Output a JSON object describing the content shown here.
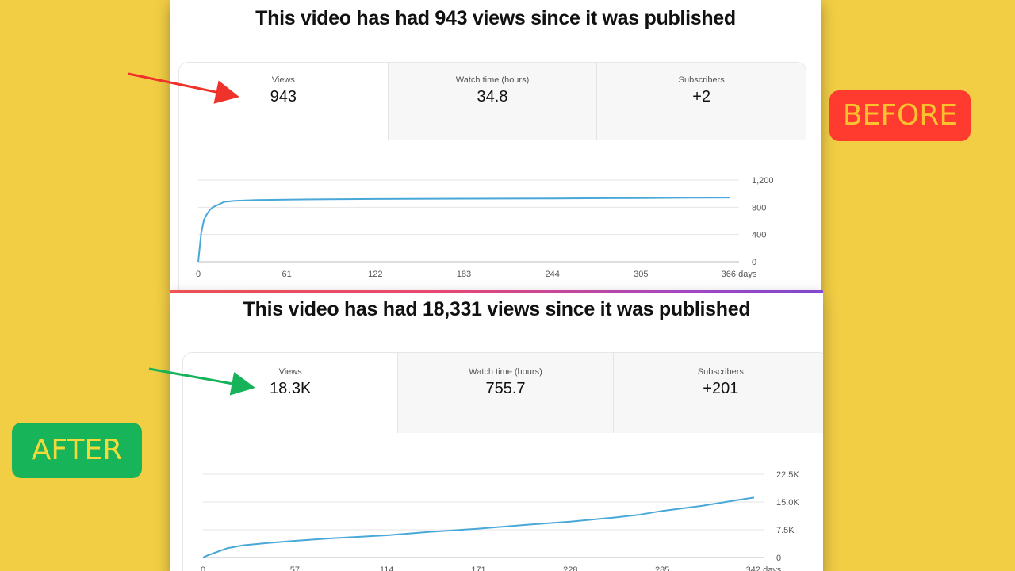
{
  "before": {
    "badge": "BEFORE",
    "headline": "This video has had 943 views since it was published",
    "tabs": [
      {
        "label": "Views",
        "value": "943"
      },
      {
        "label": "Watch time (hours)",
        "value": "34.8"
      },
      {
        "label": "Subscribers",
        "value": "+2"
      }
    ],
    "chart_data": {
      "type": "line",
      "x_ticks": [
        "0",
        "61",
        "122",
        "183",
        "244",
        "305",
        "366 days"
      ],
      "y_ticks": [
        "0",
        "400",
        "800",
        "1,200"
      ],
      "ylim": [
        0,
        1200
      ],
      "xlim": [
        0,
        366
      ],
      "series": [
        {
          "x": [
            0,
            2,
            4,
            6,
            8,
            10,
            14,
            18,
            25,
            40,
            61,
            90,
            122,
            183,
            244,
            305,
            340,
            366
          ],
          "y": [
            0,
            420,
            620,
            700,
            760,
            800,
            840,
            880,
            895,
            905,
            912,
            918,
            922,
            926,
            930,
            935,
            940,
            943
          ]
        }
      ],
      "line_color": "#4aa8d8"
    }
  },
  "after": {
    "badge": "AFTER",
    "headline": "This video has had 18,331 views since it was published",
    "tabs": [
      {
        "label": "Views",
        "value": "18.3K"
      },
      {
        "label": "Watch time (hours)",
        "value": "755.7"
      },
      {
        "label": "Subscribers",
        "value": "+201"
      }
    ],
    "chart_data": {
      "type": "line",
      "x_ticks": [
        "0",
        "57",
        "114",
        "171",
        "228",
        "285",
        "342 days"
      ],
      "y_ticks": [
        "0",
        "7.5K",
        "15.0K",
        "22.5K"
      ],
      "ylim": [
        0,
        22500
      ],
      "xlim": [
        0,
        342
      ],
      "series": [
        {
          "x": [
            0,
            3,
            8,
            15,
            25,
            40,
            57,
            80,
            114,
            140,
            171,
            200,
            228,
            255,
            270,
            285,
            310,
            330,
            342
          ],
          "y": [
            0,
            600,
            1400,
            2500,
            3300,
            3900,
            4500,
            5200,
            6000,
            6900,
            7800,
            8800,
            9700,
            10800,
            11500,
            12600,
            14000,
            15400,
            16200
          ]
        }
      ],
      "line_color": "#4aa8d8"
    }
  },
  "arrows": {
    "before_color": "#f0332a",
    "after_color": "#16b35a"
  }
}
